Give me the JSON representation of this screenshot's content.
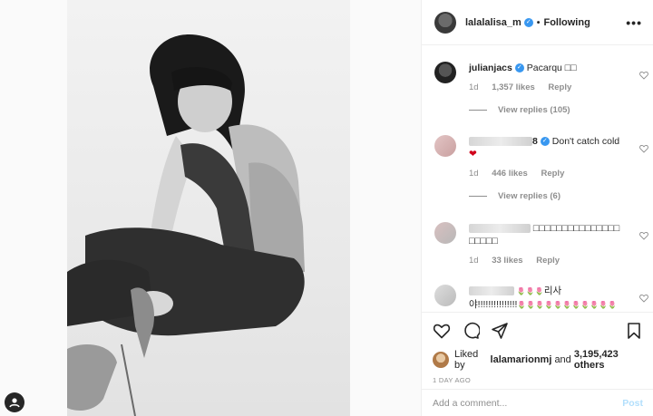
{
  "post": {
    "author": "lalalalisa_m",
    "follow_status": "Following",
    "separator": "•",
    "more_label": "•••"
  },
  "comments": [
    {
      "username": "julianjacs",
      "text": "Pacarqu □□",
      "time": "1d",
      "likes": "1,357 likes",
      "reply": "Reply",
      "view_replies": "View replies (105)"
    },
    {
      "username_suffix": "8",
      "text": "Don't catch cold",
      "time": "1d",
      "likes": "446 likes",
      "reply": "Reply",
      "view_replies": "View replies (6)"
    },
    {
      "text": "□□□□□□□□□□□□□□□□□□□□",
      "time": "1d",
      "likes": "33 likes",
      "reply": "Reply"
    },
    {
      "text_line1": "리사",
      "text_line2": "야!!!!!!!!!!!!!!!"
    }
  ],
  "likes": {
    "prefix": "Liked by",
    "user": "lalamarionmj",
    "joiner": "and",
    "count": "3,195,423 others"
  },
  "time_ago": "1 DAY AGO",
  "comment_input": {
    "placeholder": "Add a comment...",
    "post_label": "Post"
  },
  "colors": {
    "verified": "#3897f0",
    "post_disabled": "#b2dffc"
  }
}
